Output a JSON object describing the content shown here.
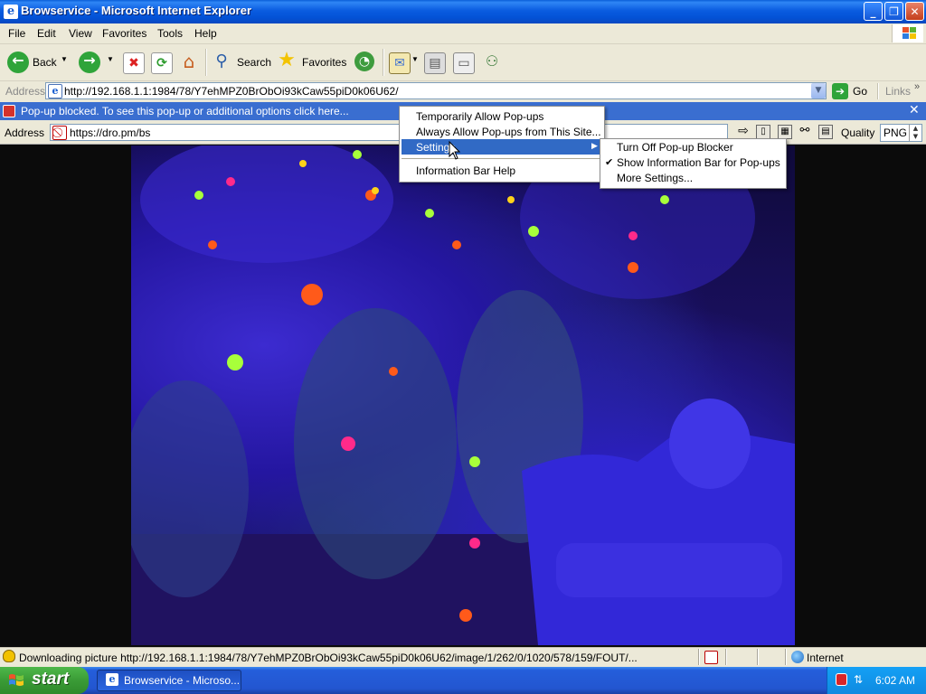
{
  "window": {
    "title": "Browservice - Microsoft Internet Explorer",
    "buttons": {
      "minimize": "_",
      "maximize": "❐",
      "close": "✕"
    }
  },
  "menubar": {
    "items": [
      "File",
      "Edit",
      "View",
      "Favorites",
      "Tools",
      "Help"
    ]
  },
  "toolbar": {
    "back_label": "Back",
    "search_label": "Search",
    "favorites_label": "Favorites"
  },
  "addressbar": {
    "label": "Address",
    "url": "http://192.168.1.1:1984/78/Y7ehMPZ0BrObOi93kCaw55piD0k06U62/",
    "go_label": "Go",
    "links_label": "Links"
  },
  "infobar": {
    "text": "Pop-up blocked. To see this pop-up or additional options click here..."
  },
  "inner_toolbar": {
    "address_label": "Address",
    "url": "https://dro.pm/bs",
    "quality_label": "Quality",
    "quality_value": "PNG"
  },
  "popup_menu": {
    "items": [
      "Temporarily Allow Pop-ups",
      "Always Allow Pop-ups from This Site...",
      "Settings",
      "Information Bar Help"
    ]
  },
  "settings_submenu": {
    "items": [
      "Turn Off Pop-up Blocker",
      "Show Information Bar for Pop-ups",
      "More Settings..."
    ],
    "checked_index": 1
  },
  "statusbar": {
    "text": "Downloading picture http://192.168.1.1:1984/78/Y7ehMPZ0BrObOi93kCaw55piD0k06U62/image/1/262/0/1020/578/159/FOUT/...",
    "zone": "Internet"
  },
  "taskbar": {
    "start_label": "start",
    "task_label": "Browservice - Microso...",
    "clock": "6:02 AM"
  }
}
